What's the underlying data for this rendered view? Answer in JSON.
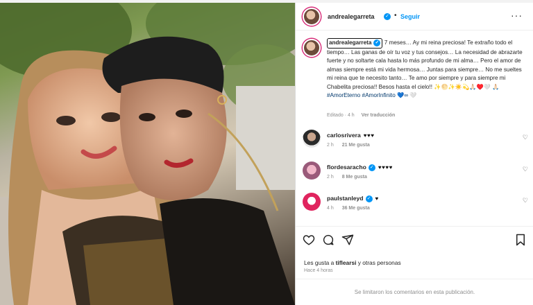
{
  "post": {
    "username": "andrealegarreta",
    "follow_label": "Seguir",
    "more_label": "···",
    "caption_text": "7 meses… Ay mi reina preciosa! Te extraño todo el tiempo… Las ganas de oír tu voz y tus consejos… La necesidad de abrazarte fuerte y no soltarte cala hasta lo más profundo de mi alma… Pero el amor de almas siempre está mi vida hermosa… Juntas para siempre… No me sueltes mi reina que te necesito tanto… Te amo por siempre y para siempre mi Chabelita preciosa!! Besos hasta el cielo!! ✨🌕✨☀️💫🙏🏻♥️🤍",
    "hashtags": "🙏🏻 #AmorEterno #AmorInfinito 💙∞ 🤍",
    "edited_time": "Editado · 4 h",
    "translate_label": "Ver traducción"
  },
  "comments": [
    {
      "username": "carlosrivera",
      "text": "♥♥♥",
      "time": "2 h",
      "likes": "21 Me gusta",
      "verified": true
    },
    {
      "username": "flordesaracho",
      "text": "♥♥♥♥",
      "time": "2 h",
      "likes": "8 Me gusta",
      "verified": true
    },
    {
      "username": "paulstanleyd",
      "text": "♥",
      "time": "4 h",
      "likes": "36 Me gusta",
      "verified": true
    }
  ],
  "footer": {
    "likes_prefix": "Les gusta a ",
    "likes_user": "tiflearsi",
    "likes_suffix": " y otras personas",
    "time_ago": "Hace 4 horas",
    "comments_limited": "Se limitaron los comentarios en esta publicación."
  },
  "icons": {
    "like": "heart-icon",
    "comment": "comment-icon",
    "share": "share-icon",
    "save": "bookmark-icon",
    "verified": "verified-badge-icon"
  },
  "colors": {
    "link_blue": "#0095f6",
    "hashtag": "#00376b",
    "muted": "#8e8e8e"
  }
}
